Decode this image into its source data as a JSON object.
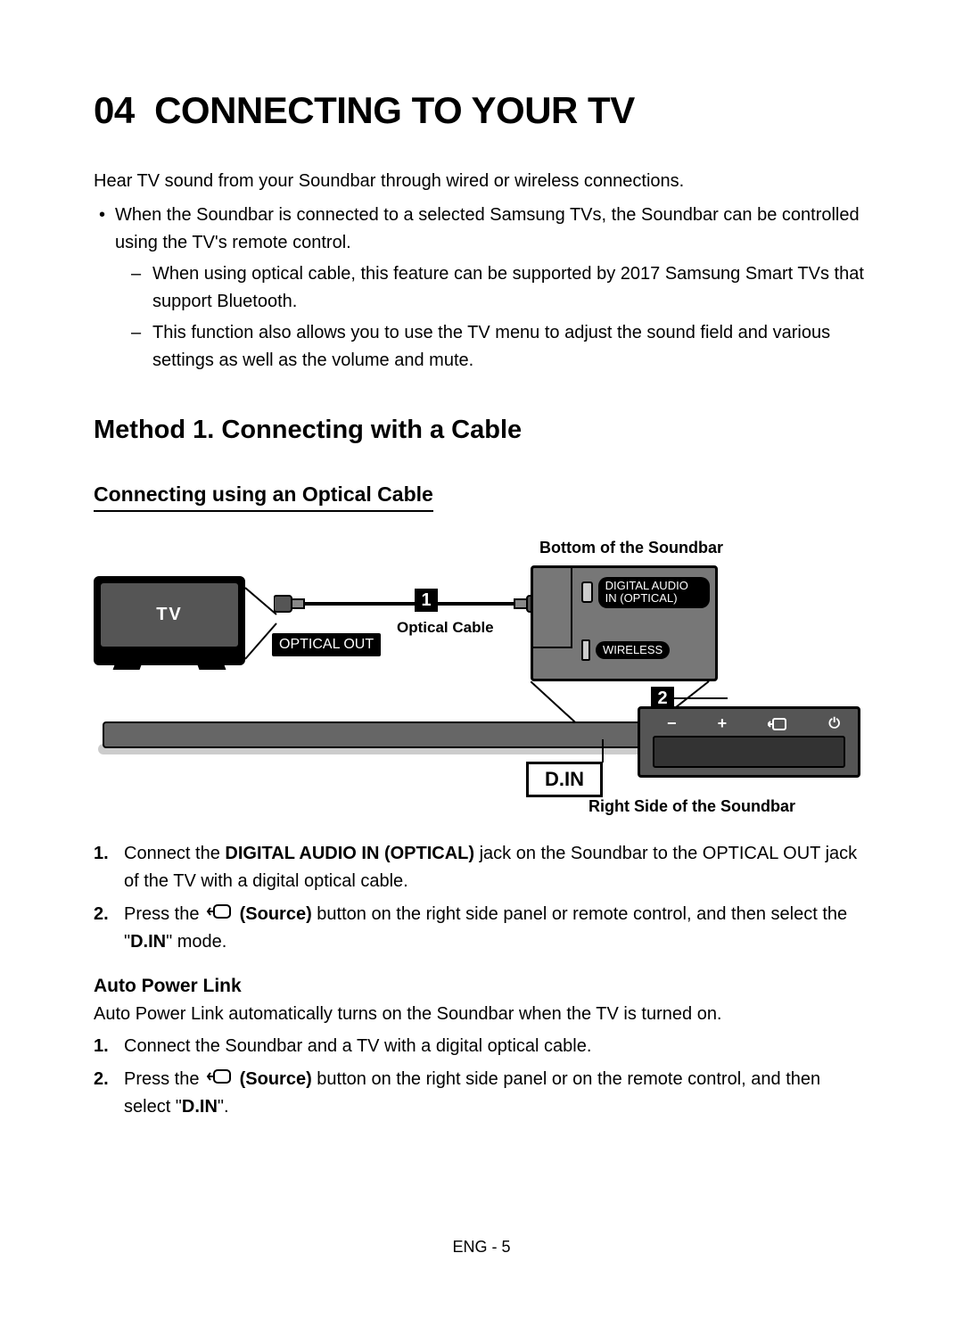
{
  "heading": {
    "num": "04",
    "title": "CONNECTING TO YOUR TV"
  },
  "intro": "Hear TV sound from your Soundbar through wired or wireless connections.",
  "bullet": "When the Soundbar is connected to a selected Samsung TVs, the Soundbar can be controlled using the TV's remote control.",
  "dashes": [
    "When using optical cable, this feature can be supported by 2017 Samsung Smart TVs that support Bluetooth.",
    "This function also allows you to use the TV menu to adjust the sound field and various settings as well as the volume and mute."
  ],
  "method_heading": "Method 1. Connecting with a Cable",
  "sub_heading": "Connecting using an Optical Cable",
  "diagram": {
    "bottom_label": "Bottom of the Soundbar",
    "tv_label": "TV",
    "optical_out": "OPTICAL OUT",
    "optical_cable": "Optical Cable",
    "digital_audio_in": "DIGITAL AUDIO IN (OPTICAL)",
    "wireless": "WIRELESS",
    "display": "D.IN",
    "right_side": "Right Side of the Soundbar",
    "badge1": "1",
    "badge2": "2",
    "minus": "−",
    "plus": "+"
  },
  "steps": {
    "s1": {
      "num": "1.",
      "a": "Connect the ",
      "b": "DIGITAL AUDIO IN (OPTICAL)",
      "c": " jack on the Soundbar to the OPTICAL OUT jack of the TV with a digital optical cable."
    },
    "s2": {
      "num": "2.",
      "a": "Press the ",
      "b": " (Source)",
      "c": " button on the right side panel or remote control, and then select the \"",
      "d": "D.IN",
      "e": "\" mode."
    }
  },
  "apl": {
    "heading": "Auto Power Link",
    "intro": "Auto Power Link automatically turns on the Soundbar when the TV is turned on.",
    "s1": {
      "num": "1.",
      "text": "Connect the Soundbar and a TV with a digital optical cable."
    },
    "s2": {
      "num": "2.",
      "a": "Press the ",
      "b": " (Source)",
      "c": " button on the right side panel or on the remote control, and then select \"",
      "d": "D.IN",
      "e": "\"."
    }
  },
  "footer": "ENG - 5"
}
